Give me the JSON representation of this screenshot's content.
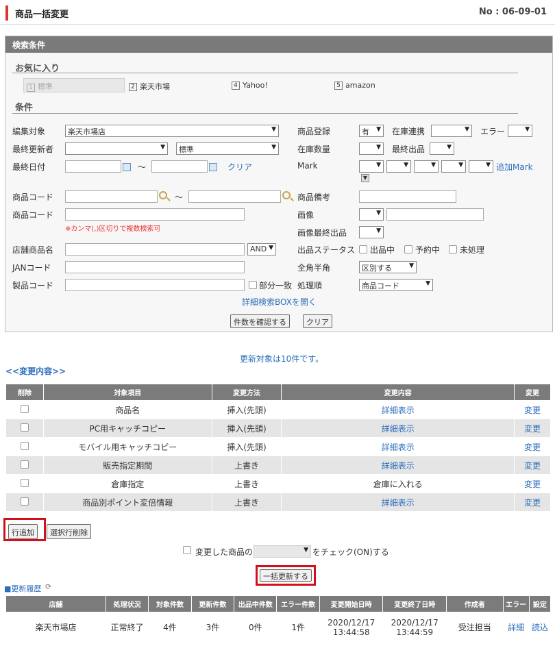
{
  "header": {
    "title": "商品一括変更",
    "no": "No : 06-09-01"
  },
  "search": {
    "panel_title": "検索条件",
    "favorites_title": "お気に入り",
    "favorites": [
      {
        "num": "1",
        "label": "標準"
      },
      {
        "num": "2",
        "label": "楽天市場"
      },
      {
        "num": "4",
        "label": "Yahoo!"
      },
      {
        "num": "5",
        "label": "amazon"
      }
    ],
    "conditions_title": "条件",
    "labels": {
      "edit_target": "編集対象",
      "last_updater": "最終更新者",
      "last_date": "最終日付",
      "product_code": "商品コード",
      "product_code2": "商品コード",
      "shop_product_name": "店舗商品名",
      "jan_code": "JANコード",
      "maker_code": "製品コード",
      "product_reg": "商品登録",
      "stock_link": "在庫連携",
      "error": "エラー",
      "stock_qty": "在庫数量",
      "last_listing": "最終出品",
      "mark": "Mark",
      "product_note": "商品備考",
      "image": "画像",
      "image_last": "画像最終出品",
      "listing_status": "出品ステータス",
      "width_mode": "全角半角",
      "order": "処理順"
    },
    "values": {
      "edit_target": "楽天市場店",
      "last_updater": "",
      "standard": "標準",
      "product_reg": "有",
      "and": "AND",
      "width_mode": "区別する",
      "order": "商品コード"
    },
    "tilde": "～",
    "clear_link": "クリア",
    "add_mark": "追加Mark",
    "comma_note": "※カンマ(,)区切りで複数検索可",
    "partial_match": "部分一致",
    "status_options": [
      "出品中",
      "予約中",
      "未処理"
    ],
    "detail_box_link": "詳細検索BOXを開く",
    "count_button": "件数を確認する",
    "clear_button": "クリア"
  },
  "update_target_text": "更新対象は10件です。",
  "changes_title": "<<変更内容>>",
  "changes_table": {
    "headers": [
      "削除",
      "対象項目",
      "変更方法",
      "変更内容",
      "変更"
    ],
    "rows": [
      {
        "item": "商品名",
        "method": "挿入(先頭)",
        "content": "詳細表示",
        "content_link": true,
        "action": "変更"
      },
      {
        "item": "PC用キャッチコピー",
        "method": "挿入(先頭)",
        "content": "詳細表示",
        "content_link": true,
        "action": "変更"
      },
      {
        "item": "モバイル用キャッチコピー",
        "method": "挿入(先頭)",
        "content": "詳細表示",
        "content_link": true,
        "action": "変更"
      },
      {
        "item": "販売指定期間",
        "method": "上書き",
        "content": "詳細表示",
        "content_link": true,
        "action": "変更"
      },
      {
        "item": "倉庫指定",
        "method": "上書き",
        "content": "倉庫に入れる",
        "content_link": false,
        "action": "変更"
      },
      {
        "item": "商品別ポイント変倍情報",
        "method": "上書き",
        "content": "詳細表示",
        "content_link": true,
        "action": "変更"
      }
    ]
  },
  "add_row_button": "行追加",
  "delete_row_button": "選択行削除",
  "check_changed": {
    "prefix": "変更した商品の",
    "suffix": "をチェック(ON)する"
  },
  "bulk_update_button": "一括更新する",
  "history_title": "■更新履歴",
  "history_table": {
    "headers": [
      "店舗",
      "処理状況",
      "対象件数",
      "更新件数",
      "出品中件数",
      "エラー件数",
      "変更開始日時",
      "変更終了日時",
      "作成者",
      "エラー",
      "設定"
    ],
    "rows": [
      {
        "shop": "楽天市場店",
        "status": "正常終了",
        "target": "4件",
        "updated": "3件",
        "listing": "0件",
        "errors": "1件",
        "start": [
          "2020/12/17",
          "13:44:58"
        ],
        "end": [
          "2020/12/17",
          "13:44:59"
        ],
        "creator": "受注担当",
        "error_link": "詳細",
        "setting_link": "読込"
      }
    ]
  },
  "colors": {
    "accent": "#d33333",
    "header_gray": "#7b7b7b",
    "link": "#2a6ebb",
    "highlight": "#d0101a"
  }
}
